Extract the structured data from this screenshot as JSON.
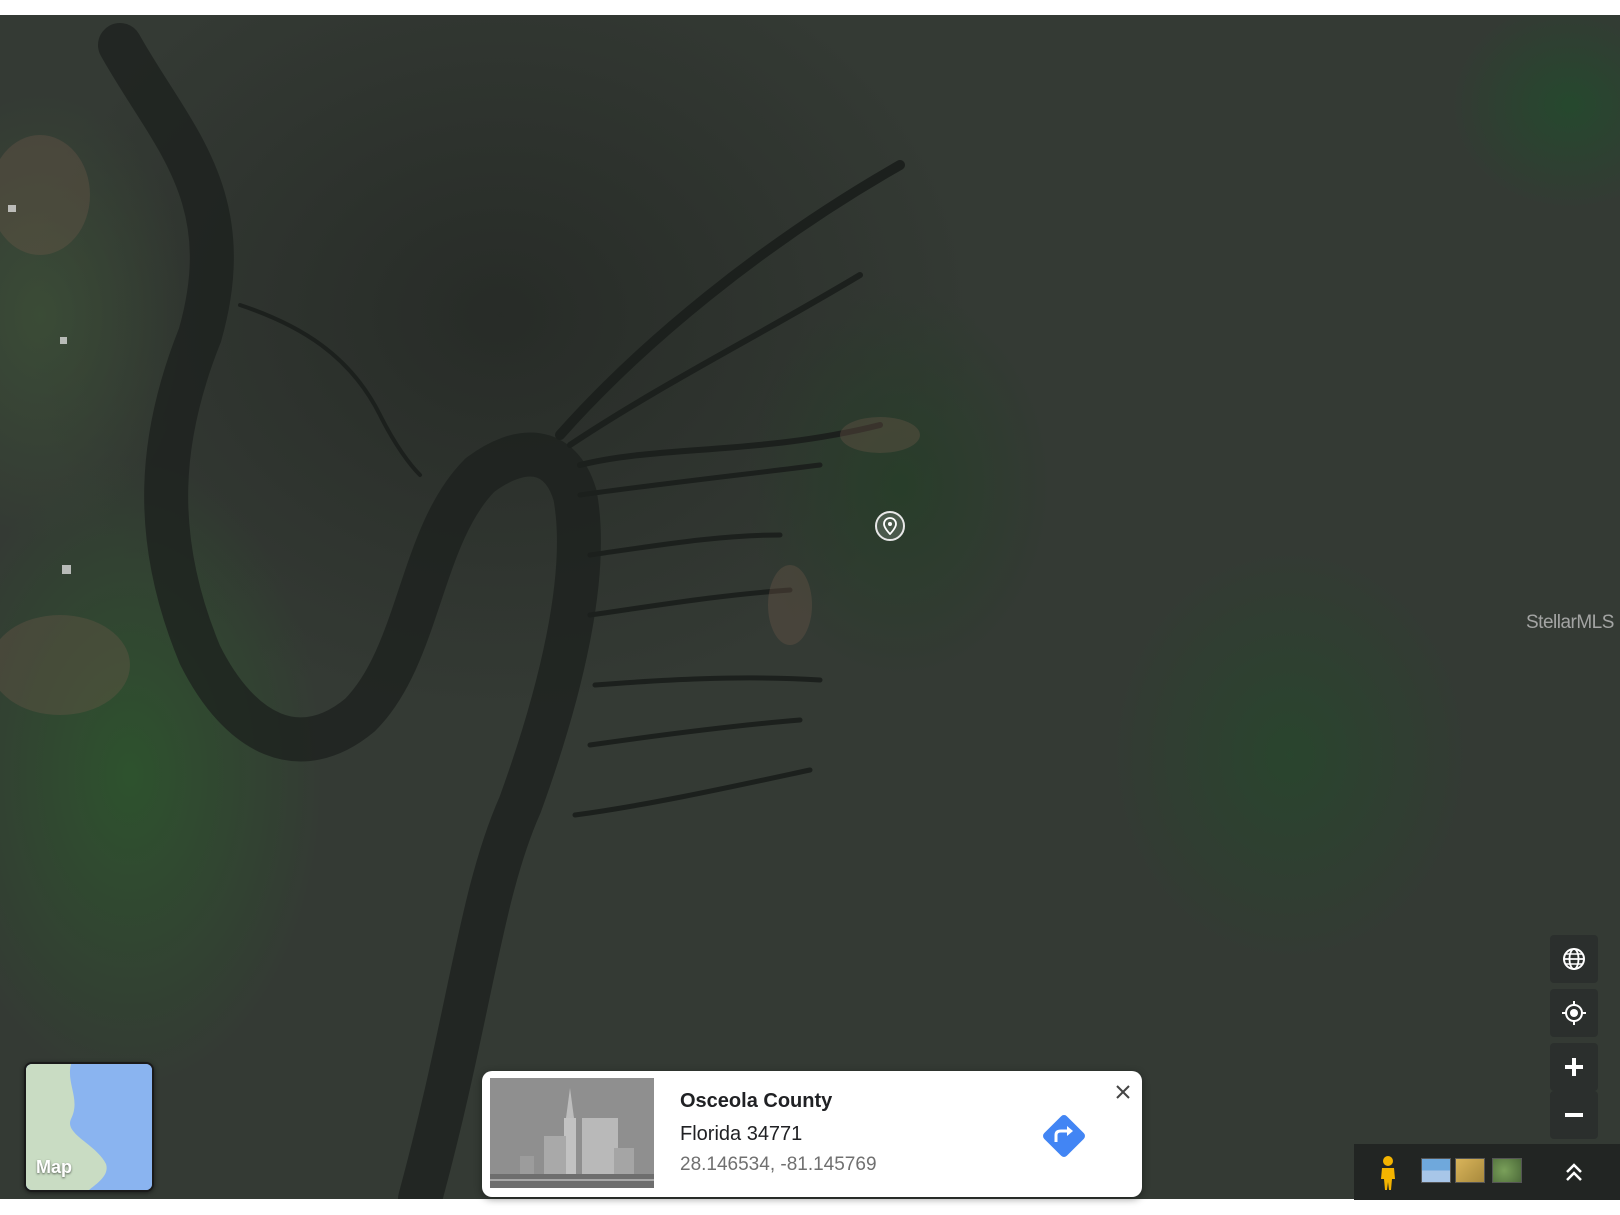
{
  "map": {
    "view_type": "satellite",
    "watermark": "StellarMLS",
    "pin_icon": "map-pin-icon"
  },
  "map_type_toggle": {
    "label": "Map"
  },
  "controls": {
    "globe": "globe-icon",
    "my_location": "my-location-icon",
    "zoom_in": "plus-icon",
    "zoom_out": "minus-icon",
    "pegman": "pegman-icon",
    "expand": "chevron-up-double-icon"
  },
  "location_card": {
    "title": "Osceola County",
    "subtitle": "Florida 34771",
    "coordinates": "28.146534, -81.145769",
    "directions_color": "#4285f4"
  },
  "colors": {
    "card_bg": "#ffffff",
    "control_bg": "#2b2f2d",
    "pegman": "#f4b400"
  }
}
